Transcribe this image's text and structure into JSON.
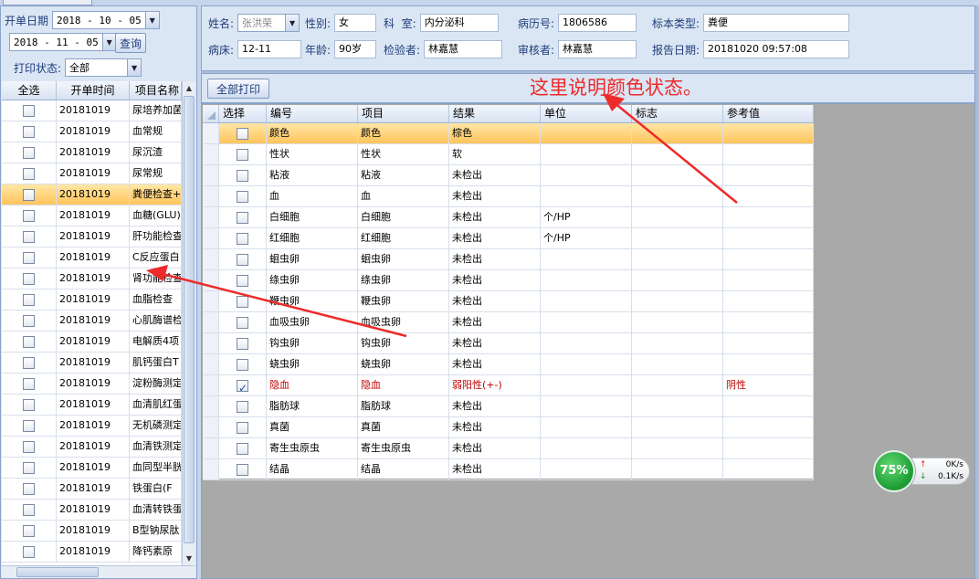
{
  "filters": {
    "start_label": "开单日期",
    "start_date": "2018 - 10 - 05",
    "end_date": "2018 - 11 - 05",
    "query_label": "查询",
    "print_status_label": "打印状态:",
    "print_status_value": "全部"
  },
  "left_grid": {
    "headers": [
      "全选",
      "开单时间",
      "项目名称"
    ],
    "rows": [
      {
        "time": "20181019",
        "item": "尿培养加菌",
        "checked": false,
        "selected": false
      },
      {
        "time": "20181019",
        "item": "血常规",
        "checked": false,
        "selected": false
      },
      {
        "time": "20181019",
        "item": "尿沉渣",
        "checked": false,
        "selected": false
      },
      {
        "time": "20181019",
        "item": "尿常规",
        "checked": false,
        "selected": false
      },
      {
        "time": "20181019",
        "item": "粪便检查+",
        "checked": false,
        "selected": true
      },
      {
        "time": "20181019",
        "item": "血糖(GLU)",
        "checked": false,
        "selected": false
      },
      {
        "time": "20181019",
        "item": "肝功能检查",
        "checked": false,
        "selected": false
      },
      {
        "time": "20181019",
        "item": "C反应蛋白",
        "checked": false,
        "selected": false
      },
      {
        "time": "20181019",
        "item": "肾功能检查",
        "checked": false,
        "selected": false
      },
      {
        "time": "20181019",
        "item": "血脂检查",
        "checked": false,
        "selected": false
      },
      {
        "time": "20181019",
        "item": "心肌酶谱检",
        "checked": false,
        "selected": false
      },
      {
        "time": "20181019",
        "item": "电解质4项",
        "checked": false,
        "selected": false
      },
      {
        "time": "20181019",
        "item": "肌钙蛋白T",
        "checked": false,
        "selected": false
      },
      {
        "time": "20181019",
        "item": "淀粉酶测定",
        "checked": false,
        "selected": false
      },
      {
        "time": "20181019",
        "item": "血清肌红蛋",
        "checked": false,
        "selected": false
      },
      {
        "time": "20181019",
        "item": "无机磷测定",
        "checked": false,
        "selected": false
      },
      {
        "time": "20181019",
        "item": "血清铁测定",
        "checked": false,
        "selected": false
      },
      {
        "time": "20181019",
        "item": "血同型半胱",
        "checked": false,
        "selected": false
      },
      {
        "time": "20181019",
        "item": "铁蛋白(F",
        "checked": false,
        "selected": false
      },
      {
        "time": "20181019",
        "item": "血清转铁蛋",
        "checked": false,
        "selected": false
      },
      {
        "time": "20181019",
        "item": "B型钠尿肽",
        "checked": false,
        "selected": false
      },
      {
        "time": "20181019",
        "item": "降钙素原",
        "checked": false,
        "selected": false
      }
    ]
  },
  "patient": {
    "name_label": "姓名:",
    "name": "张洪荣",
    "sex_label": "性别:",
    "sex": "女",
    "dept_label": "科  室:",
    "dept": "内分泌科",
    "record_label": "病历号:",
    "record": "1806586",
    "sample_label": "标本类型:",
    "sample": "粪便",
    "bed_label": "病床:",
    "bed": "12-11",
    "age_label": "年龄:",
    "age": "90岁",
    "tester_label": "检验者:",
    "tester": "林嘉慧",
    "reviewer_label": "审核者:",
    "reviewer": "林嘉慧",
    "report_label": "报告日期:",
    "report_date": "20181020 09:57:08"
  },
  "toolbar": {
    "print_all": "全部打印"
  },
  "annotation": "这里说明颜色状态。",
  "result_grid": {
    "headers": [
      "选择",
      "编号",
      "项目",
      "结果",
      "单位",
      "标志",
      "参考值"
    ],
    "rows": [
      {
        "code": "颜色",
        "item": "颜色",
        "result": "棕色",
        "unit": "",
        "flag": "",
        "ref": "",
        "checked": false,
        "selected": true,
        "abnormal": false
      },
      {
        "code": "性状",
        "item": "性状",
        "result": "软",
        "unit": "",
        "flag": "",
        "ref": "",
        "checked": false,
        "selected": false,
        "abnormal": false
      },
      {
        "code": "粘液",
        "item": "粘液",
        "result": "未检出",
        "unit": "",
        "flag": "",
        "ref": "",
        "checked": false,
        "selected": false,
        "abnormal": false
      },
      {
        "code": "血",
        "item": "血",
        "result": "未检出",
        "unit": "",
        "flag": "",
        "ref": "",
        "checked": false,
        "selected": false,
        "abnormal": false
      },
      {
        "code": "白细胞",
        "item": "白细胞",
        "result": "未检出",
        "unit": "个/HP",
        "flag": "",
        "ref": "",
        "checked": false,
        "selected": false,
        "abnormal": false
      },
      {
        "code": "红细胞",
        "item": "红细胞",
        "result": "未检出",
        "unit": "个/HP",
        "flag": "",
        "ref": "",
        "checked": false,
        "selected": false,
        "abnormal": false
      },
      {
        "code": "蛔虫卵",
        "item": "蛔虫卵",
        "result": "未检出",
        "unit": "",
        "flag": "",
        "ref": "",
        "checked": false,
        "selected": false,
        "abnormal": false
      },
      {
        "code": "绦虫卵",
        "item": "绦虫卵",
        "result": "未检出",
        "unit": "",
        "flag": "",
        "ref": "",
        "checked": false,
        "selected": false,
        "abnormal": false
      },
      {
        "code": "鞭虫卵",
        "item": "鞭虫卵",
        "result": "未检出",
        "unit": "",
        "flag": "",
        "ref": "",
        "checked": false,
        "selected": false,
        "abnormal": false
      },
      {
        "code": "血吸虫卵",
        "item": "血吸虫卵",
        "result": "未检出",
        "unit": "",
        "flag": "",
        "ref": "",
        "checked": false,
        "selected": false,
        "abnormal": false
      },
      {
        "code": "钩虫卵",
        "item": "钩虫卵",
        "result": "未检出",
        "unit": "",
        "flag": "",
        "ref": "",
        "checked": false,
        "selected": false,
        "abnormal": false
      },
      {
        "code": "蛲虫卵",
        "item": "蛲虫卵",
        "result": "未检出",
        "unit": "",
        "flag": "",
        "ref": "",
        "checked": false,
        "selected": false,
        "abnormal": false
      },
      {
        "code": "隐血",
        "item": "隐血",
        "result": "弱阳性(+-)",
        "unit": "",
        "flag": "",
        "ref": "阴性",
        "checked": true,
        "selected": false,
        "abnormal": true
      },
      {
        "code": "脂肪球",
        "item": "脂肪球",
        "result": "未检出",
        "unit": "",
        "flag": "",
        "ref": "",
        "checked": false,
        "selected": false,
        "abnormal": false
      },
      {
        "code": "真菌",
        "item": "真菌",
        "result": "未检出",
        "unit": "",
        "flag": "",
        "ref": "",
        "checked": false,
        "selected": false,
        "abnormal": false
      },
      {
        "code": "寄生虫原虫",
        "item": "寄生虫原虫",
        "result": "未检出",
        "unit": "",
        "flag": "",
        "ref": "",
        "checked": false,
        "selected": false,
        "abnormal": false
      },
      {
        "code": "结晶",
        "item": "结晶",
        "result": "未检出",
        "unit": "",
        "flag": "",
        "ref": "",
        "checked": false,
        "selected": false,
        "abnormal": false
      }
    ]
  },
  "net_widget": {
    "percent": "75%",
    "up": "0K/s",
    "down": "0.1K/s"
  },
  "colors": {
    "annotation": "#ee2a2a",
    "selected_row": "#ffc45c",
    "abnormal_text": "#c00000"
  }
}
